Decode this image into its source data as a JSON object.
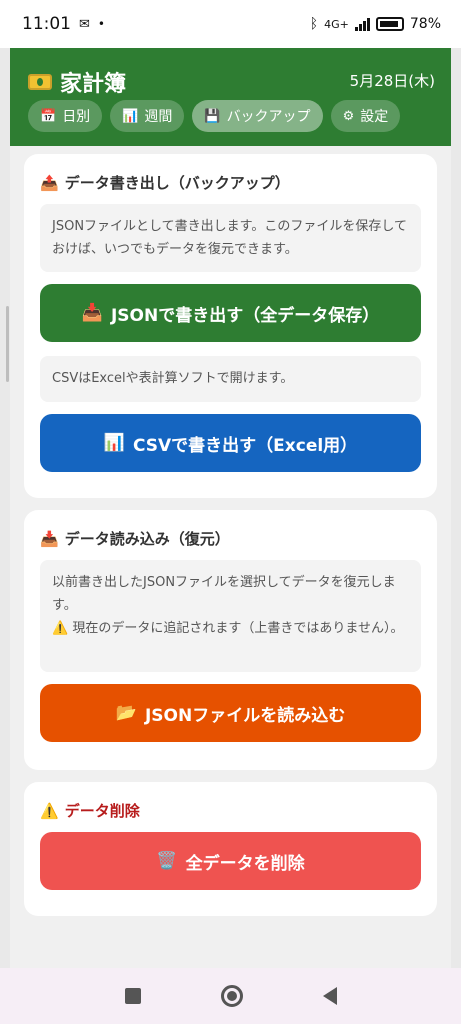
{
  "status_bar": {
    "time": "11:01",
    "battery_percent": "78"
  },
  "header": {
    "title": "家計簿",
    "date": "5月28日(木)",
    "tabs": [
      {
        "label": "日別",
        "icon": "calendar-icon"
      },
      {
        "label": "週間",
        "icon": "chart-icon"
      },
      {
        "label": "バックアップ",
        "icon": "disk-icon",
        "active": true
      },
      {
        "label": "設定",
        "icon": "gear-icon"
      }
    ]
  },
  "export": {
    "title": "データ書き出し（バックアップ）",
    "json_note": "JSONファイルとして書き出します。このファイルを保存しておけば、いつでもデータを復元できます。",
    "json_button": "JSONで書き出す（全データ保存）",
    "csv_note": "CSVはExcelや表計算ソフトで開けます。",
    "csv_button": "CSVで書き出す（Excel用）"
  },
  "import": {
    "title": "データ読み込み（復元）",
    "note_line1": "以前書き出したJSONファイルを選択してデータを復元します。",
    "note_warning": "現在のデータに追記されます（上書きではありません）。",
    "button": "JSONファイルを読み込む"
  },
  "delete": {
    "title": "データ削除",
    "button": "全データを削除"
  },
  "colors": {
    "header": "#2e7d32",
    "green_button": "#2e7d32",
    "blue_button": "#1565c0",
    "orange_button": "#e65100",
    "red_button": "#ef5350"
  }
}
